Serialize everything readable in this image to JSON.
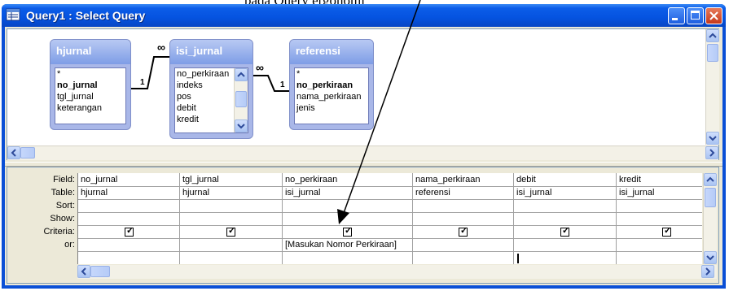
{
  "caption": {
    "text": "pada Query ergonomi"
  },
  "window": {
    "title": "Query1 : Select Query"
  },
  "tables": [
    {
      "name": "hjurnal",
      "fields": [
        {
          "label": "*",
          "bold": false
        },
        {
          "label": "no_jurnal",
          "bold": true
        },
        {
          "label": "tgl_jurnal",
          "bold": false
        },
        {
          "label": "keterangan",
          "bold": false
        }
      ]
    },
    {
      "name": "isi_jurnal",
      "fields": [
        {
          "label": "no_perkiraan",
          "bold": false
        },
        {
          "label": "indeks",
          "bold": false
        },
        {
          "label": "pos",
          "bold": false
        },
        {
          "label": "debit",
          "bold": false
        },
        {
          "label": "kredit",
          "bold": false
        }
      ]
    },
    {
      "name": "referensi",
      "fields": [
        {
          "label": "*",
          "bold": false
        },
        {
          "label": "no_perkiraan",
          "bold": true
        },
        {
          "label": "nama_perkiraan",
          "bold": false
        },
        {
          "label": "jenis",
          "bold": false
        }
      ]
    }
  ],
  "joins": [
    {
      "many": "∞",
      "one": "1"
    },
    {
      "many": "∞",
      "one": "1"
    }
  ],
  "grid": {
    "row_labels": [
      "Field:",
      "Table:",
      "Sort:",
      "Show:",
      "Criteria:",
      "or:"
    ],
    "columns": [
      {
        "field": "no_jurnal",
        "table": "hjurnal",
        "show": true,
        "criteria": ""
      },
      {
        "field": "tgl_jurnal",
        "table": "hjurnal",
        "show": true,
        "criteria": ""
      },
      {
        "field": "no_perkiraan",
        "table": "isi_jurnal",
        "show": true,
        "criteria": "[Masukan Nomor Perkiraan]"
      },
      {
        "field": "nama_perkiraan",
        "table": "referensi",
        "show": true,
        "criteria": ""
      },
      {
        "field": "debit",
        "table": "isi_jurnal",
        "show": true,
        "criteria": ""
      },
      {
        "field": "kredit",
        "table": "isi_jurnal",
        "show": true,
        "criteria": ""
      }
    ]
  },
  "colors": {
    "titlebar": "#0553e0",
    "client": "#ece9d8",
    "table_header": "#7e9de6"
  }
}
